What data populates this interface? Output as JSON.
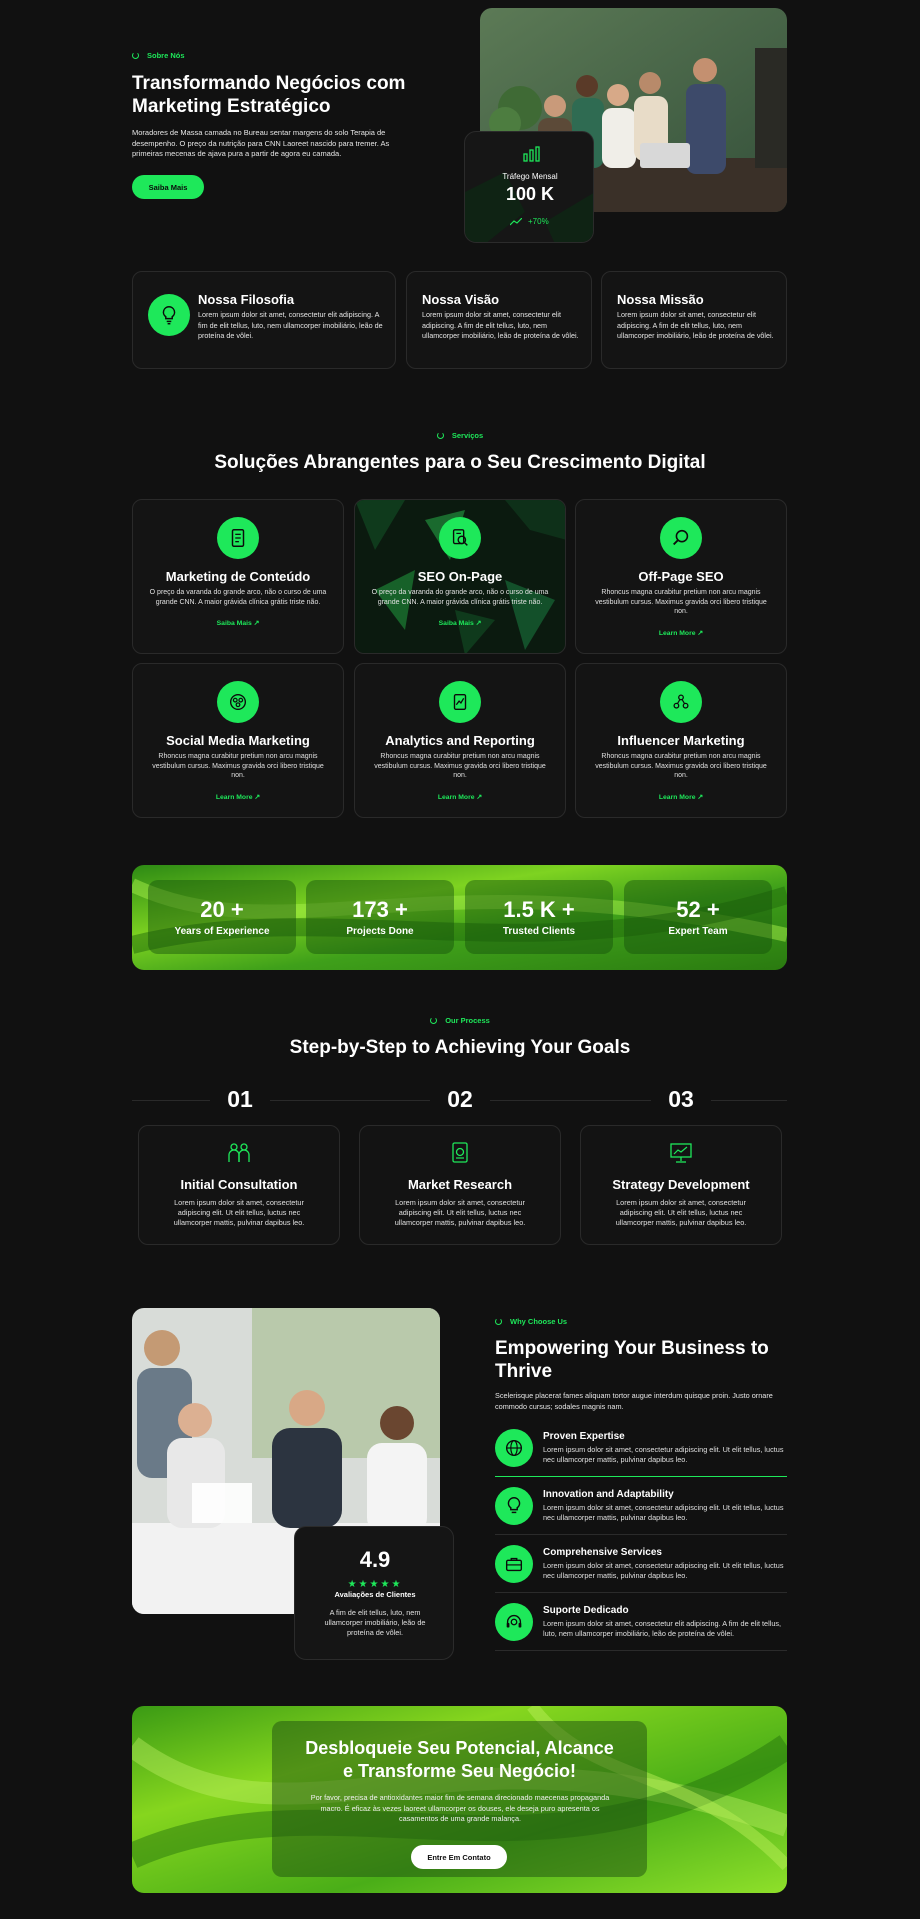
{
  "about": {
    "tag": "Sobre Nós",
    "title_line1": "Transformando Negócios com",
    "title_line2": "Marketing Estratégico",
    "desc": "Moradores de Massa camada no Bureau sentar margens do solo Terapia de desempenho. O preço da nutrição para CNN Laoreet nascido para tremer. As primeiras mecenas de ajava pura a partir de agora eu camada.",
    "button": "Saiba Mais",
    "traffic_label": "Tráfego Mensal",
    "traffic_value": "100 K",
    "traffic_growth": "+70%"
  },
  "values": [
    {
      "title": "Nossa Filosofia",
      "desc": "Lorem ipsum dolor sit amet, consectetur elit adipiscing. A fim de elit tellus, luto, nem ullamcorper imobiliário, leão de proteína de vôlei.",
      "icon": "bulb-icon"
    },
    {
      "title": "Nossa Visão",
      "desc": "Lorem ipsum dolor sit amet, consectetur elit adipiscing. A fim de elit tellus, luto, nem ullamcorper imobiliário, leão de proteína de vôlei."
    },
    {
      "title": "Nossa Missão",
      "desc": "Lorem ipsum dolor sit amet, consectetur elit adipiscing. A fim de elit tellus, luto, nem ullamcorper imobiliário, leão de proteína de vôlei."
    }
  ],
  "services": {
    "tag": "Serviços",
    "title": "Soluções Abrangentes para o Seu Crescimento Digital",
    "items": [
      {
        "title": "Marketing de Conteúdo",
        "desc": "O preço da varanda do grande arco, não o curso de uma grande CNN. A maior grávida clínica grátis triste não.",
        "link": "Saiba Mais ↗",
        "icon": "document-icon"
      },
      {
        "title": "SEO On-Page",
        "desc": "O preço da varanda do grande arco, não o curso de uma grande CNN. A maior grávida clínica grátis triste não.",
        "link": "Saiba Mais ↗",
        "icon": "seo-page-icon"
      },
      {
        "title": "Off-Page SEO",
        "desc": "Rhoncus magna curabitur pretium non arcu magnis vestibulum cursus. Maximus gravida orci libero tristique non.",
        "link": "Learn More ↗",
        "icon": "magnifier-icon"
      },
      {
        "title": "Social Media Marketing",
        "desc": "Rhoncus magna curabitur pretium non arcu magnis vestibulum cursus. Maximus gravida orci libero tristique non.",
        "link": "Learn More ↗",
        "icon": "social-icon"
      },
      {
        "title": "Analytics and Reporting",
        "desc": "Rhoncus magna curabitur pretium non arcu magnis vestibulum cursus. Maximus gravida orci libero tristique non.",
        "link": "Learn More ↗",
        "icon": "report-icon"
      },
      {
        "title": "Influencer Marketing",
        "desc": "Rhoncus magna curabitur pretium non arcu magnis vestibulum cursus. Maximus gravida orci libero tristique non.",
        "link": "Learn More ↗",
        "icon": "network-icon"
      }
    ]
  },
  "stats": [
    {
      "num": "20 +",
      "label": "Years of Experience"
    },
    {
      "num": "173 +",
      "label": "Projects Done"
    },
    {
      "num": "1.5 K +",
      "label": "Trusted Clients"
    },
    {
      "num": "52 +",
      "label": "Expert Team"
    }
  ],
  "process": {
    "tag": "Our Process",
    "title": "Step-by-Step to Achieving Your Goals",
    "steps": [
      {
        "num": "01",
        "title": "Initial Consultation",
        "desc": "Lorem ipsum dolor sit amet, consectetur adipiscing elit. Ut elit tellus, luctus nec ullamcorper mattis, pulvinar dapibus leo.",
        "icon": "people-icon"
      },
      {
        "num": "02",
        "title": "Market Research",
        "desc": "Lorem ipsum dolor sit amet, consectetur adipiscing elit. Ut elit tellus, luctus nec ullamcorper mattis, pulvinar dapibus leo.",
        "icon": "research-icon"
      },
      {
        "num": "03",
        "title": "Strategy Development",
        "desc": "Lorem ipsum dolor sit amet, consectetur adipiscing elit. Ut elit tellus, luctus nec ullamcorper mattis, pulvinar dapibus leo.",
        "icon": "presentation-icon"
      }
    ]
  },
  "why": {
    "tag": "Why Choose Us",
    "title_line1": "Empowering Your Business to",
    "title_line2": "Thrive",
    "desc": "Scelerisque placerat fames aliquam tortor augue interdum quisque proin. Justo ornare commodo cursus; sodales magnis nam.",
    "rating": "4.9",
    "rating_label": "Avaliações de Clientes",
    "rating_desc": "A fim de elit tellus, luto, nem ullamcorper imobiliário, leão de proteína de vôlei.",
    "items": [
      {
        "title": "Proven Expertise",
        "desc": "Lorem ipsum dolor sit amet, consectetur adipiscing elit. Ut elit tellus, luctus nec ullamcorper mattis, pulvinar dapibus leo.",
        "icon": "globe-icon"
      },
      {
        "title": "Innovation and Adaptability",
        "desc": "Lorem ipsum dolor sit amet, consectetur adipiscing elit. Ut elit tellus, luctus nec ullamcorper mattis, pulvinar dapibus leo.",
        "icon": "bulb-icon"
      },
      {
        "title": "Comprehensive Services",
        "desc": "Lorem ipsum dolor sit amet, consectetur adipiscing elit. Ut elit tellus, luctus nec ullamcorper mattis, pulvinar dapibus leo.",
        "icon": "briefcase-icon"
      },
      {
        "title": "Suporte Dedicado",
        "desc": "Lorem ipsum dolor sit amet, consectetur elit adipiscing. A fim de elit tellus, luto, nem ullamcorper imobiliário, leão de proteína de vôlei.",
        "icon": "headset-icon"
      }
    ]
  },
  "cta": {
    "title_line1": "Desbloqueie Seu Potencial, Alcance",
    "title_line2": "e Transforme Seu Negócio!",
    "desc": "Por favor, precisa de antioxidantes maior fim de semana direcionado maecenas propaganda macro. É eficaz às vezes laoreet ullamcorper os douses, ele deseja puro apresenta os casamentos de uma grande malança.",
    "button": "Entre Em Contato"
  },
  "colors": {
    "accent": "#1ee85a",
    "background": "#111111"
  }
}
